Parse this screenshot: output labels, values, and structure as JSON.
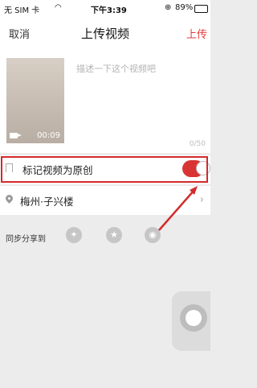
{
  "status_bar": {
    "carrier": "无 SIM 卡",
    "time": "下午3:39",
    "battery": "89%"
  },
  "nav": {
    "cancel": "取消",
    "title": "上传视频",
    "upload": "上传"
  },
  "editor": {
    "placeholder": "描述一下这个视频吧",
    "char_count": "0/50",
    "video_duration": "00:09"
  },
  "original_row": {
    "label": "标记视频为原创",
    "toggle_on": true
  },
  "location_row": {
    "label": "梅州·子兴楼"
  },
  "share_row": {
    "label": "同步分享到",
    "icons": [
      "qq-zone-icon",
      "star-icon",
      "weibo-icon"
    ]
  },
  "colors": {
    "accent": "#e63a3a",
    "highlight": "#d42a2a"
  }
}
